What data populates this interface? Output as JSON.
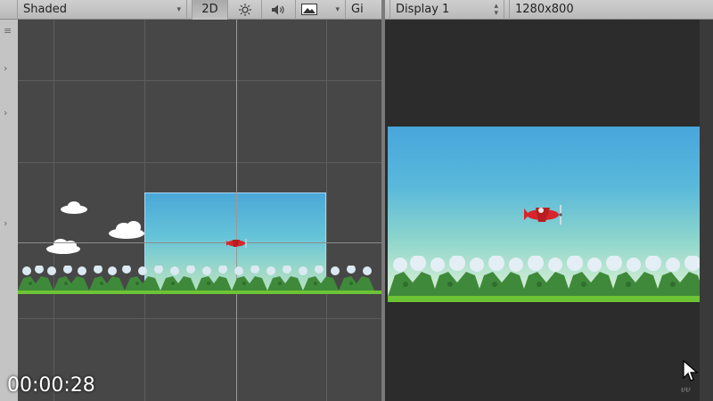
{
  "scene_toolbar": {
    "shading_mode": "Shaded",
    "mode_2d": "2D",
    "lighting_icon": "sun-icon",
    "audio_icon": "speaker-icon",
    "effects_icon": "image-icon",
    "gizmos_label": "Gi"
  },
  "game_toolbar": {
    "display": "Display 1",
    "resolution": "1280x800"
  },
  "overlay": {
    "timestamp": "00:00:28",
    "watermark": "ᵾᵾ"
  },
  "colors": {
    "sky_top": "#48a6dc",
    "sky_bottom": "#c9ead2",
    "grass": "#6cc434",
    "plane": "#d7262b",
    "scene_bg": "#474747",
    "game_bg": "#2c2c2c"
  }
}
